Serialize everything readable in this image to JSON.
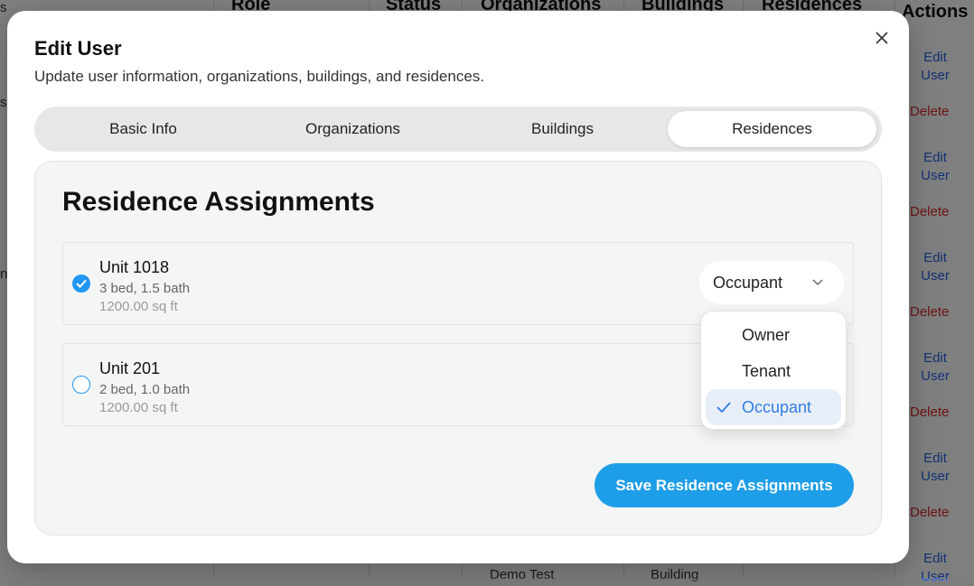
{
  "background": {
    "headers": [
      "Role",
      "Status",
      "Organizations",
      "Buildings",
      "Residences",
      "Actions"
    ],
    "left_fragments": [
      "s",
      "s",
      "n"
    ],
    "row_actions": [
      {
        "edit": "Edit User",
        "delete": "Delete"
      },
      {
        "edit": "Edit User",
        "delete": "Delete"
      },
      {
        "edit": "Edit User",
        "delete": "Delete"
      },
      {
        "edit": "Edit User",
        "delete": "Delete"
      },
      {
        "edit": "Edit User",
        "delete": "Delete"
      },
      {
        "edit": "Edit User"
      }
    ],
    "bottom_row": {
      "name": "Demo Test",
      "building": "Building"
    }
  },
  "modal": {
    "title": "Edit User",
    "description": "Update user information, organizations, buildings, and residences.",
    "close_icon": "close-icon",
    "tabs": [
      "Basic Info",
      "Organizations",
      "Buildings",
      "Residences"
    ],
    "active_tab": "Residences",
    "panel": {
      "title": "Residence Assignments",
      "units": [
        {
          "name": "Unit 1018",
          "beds": "3 bed, 1.5 bath",
          "area": "1200.00 sq ft",
          "checked": true,
          "role": "Occupant"
        },
        {
          "name": "Unit 201",
          "beds": "2 bed, 1.0 bath",
          "area": "1200.00 sq ft",
          "checked": false
        }
      ],
      "role_options": [
        "Owner",
        "Tenant",
        "Occupant"
      ],
      "selected_role": "Occupant",
      "save_label": "Save Residence Assignments"
    }
  },
  "colors": {
    "accent": "#1e9de8",
    "delete": "#dc2626",
    "link": "#2563eb"
  }
}
